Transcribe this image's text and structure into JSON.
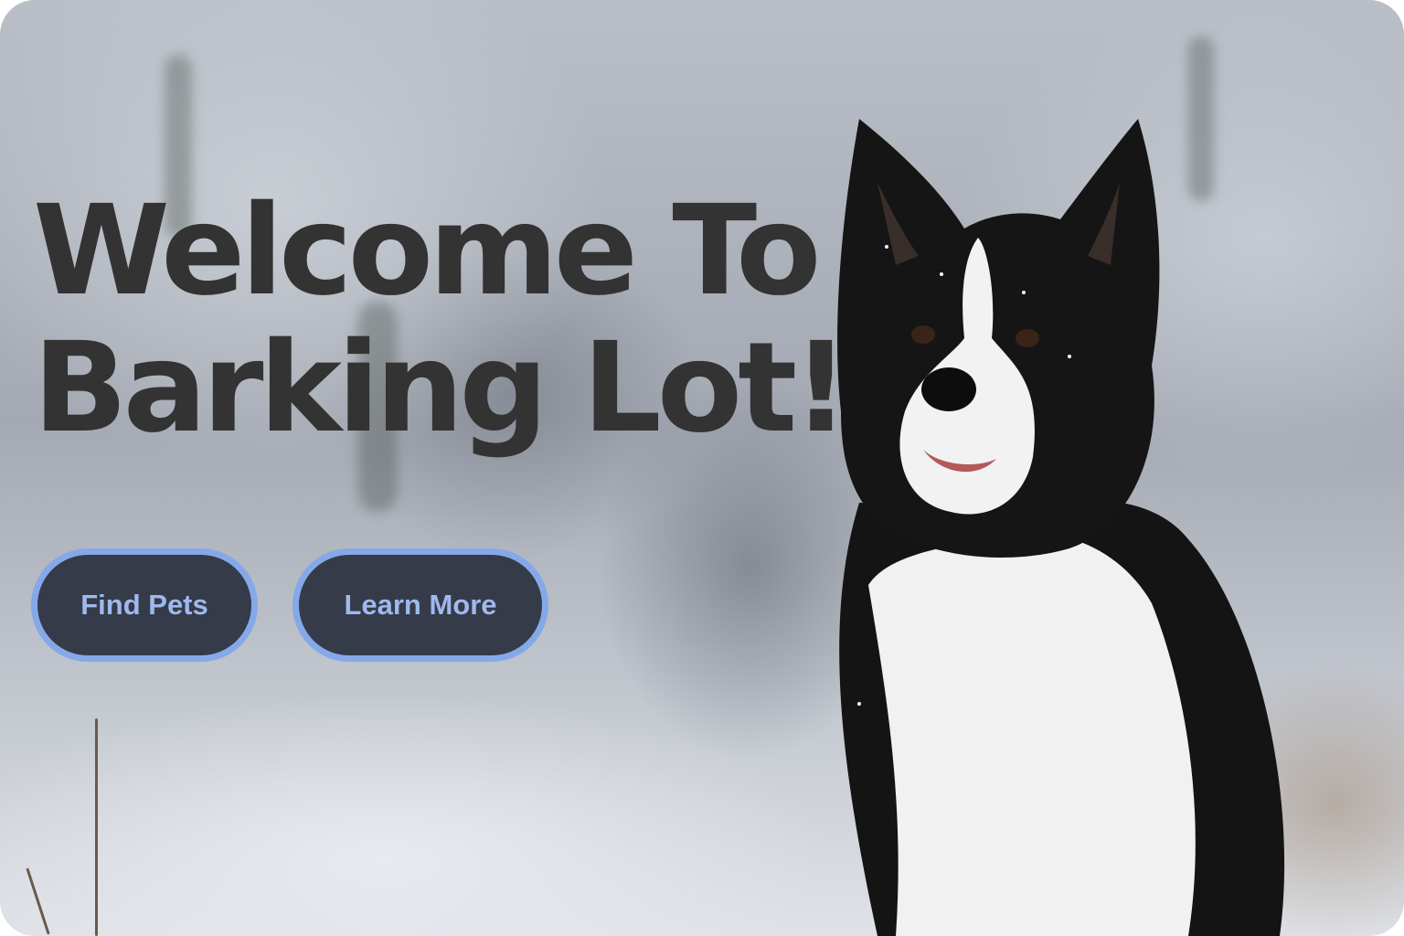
{
  "hero": {
    "title": "Welcome To\nBarking Lot!",
    "buttons": {
      "find_pets": "Find Pets",
      "learn_more": "Learn More"
    },
    "background_image": "border-collie-in-snowy-forest",
    "colors": {
      "title": "#333333",
      "button_bg": "#353b48",
      "button_border": "#85a9e8",
      "button_text": "#9fb9ee"
    }
  }
}
